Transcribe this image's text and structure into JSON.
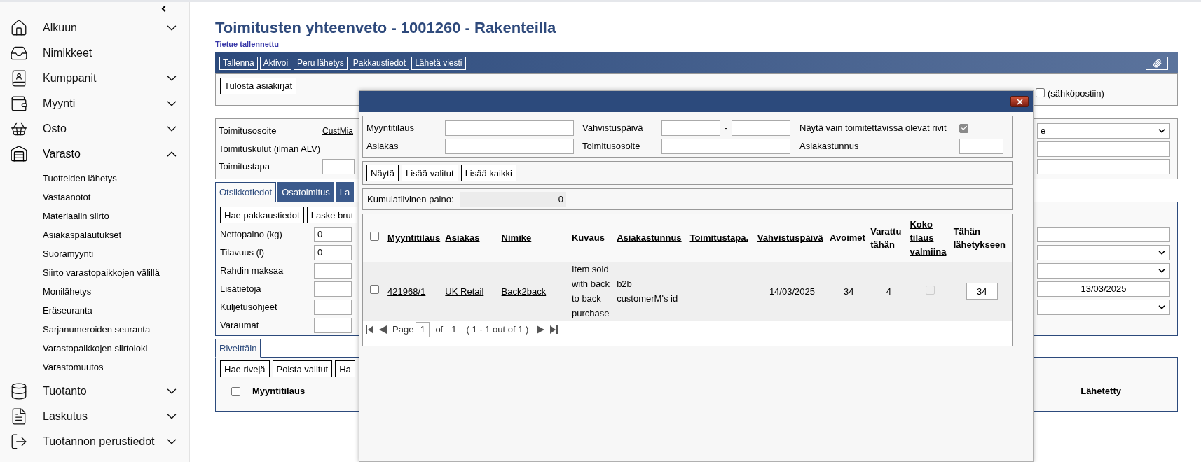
{
  "sidebar": {
    "items": [
      {
        "label": "Alkuun",
        "kind": "group",
        "expanded": false
      },
      {
        "label": "Nimikkeet",
        "kind": "link"
      },
      {
        "label": "Kumppanit",
        "kind": "group",
        "expanded": false
      },
      {
        "label": "Myynti",
        "kind": "group",
        "expanded": false
      },
      {
        "label": "Osto",
        "kind": "group",
        "expanded": false
      },
      {
        "label": "Varasto",
        "kind": "group",
        "expanded": true,
        "children": [
          {
            "label": "Tuotteiden lähetys"
          },
          {
            "label": "Vastaanotot"
          },
          {
            "label": "Materiaalin siirto"
          },
          {
            "label": "Asiakaspalautukset"
          },
          {
            "label": "Suoramyynti"
          },
          {
            "label": "Siirto varastopaikkojen välillä"
          },
          {
            "label": "Monilähetys"
          },
          {
            "label": "Eräseuranta"
          },
          {
            "label": "Sarjanumeroiden seuranta"
          },
          {
            "label": "Varastopaikkojen siirtoloki"
          },
          {
            "label": "Varastomuutos"
          }
        ]
      },
      {
        "label": "Tuotanto",
        "kind": "group",
        "expanded": false
      },
      {
        "label": "Laskutus",
        "kind": "group",
        "expanded": false
      },
      {
        "label": "Tuotannon perustiedot",
        "kind": "group",
        "expanded": false
      }
    ]
  },
  "page": {
    "title": "Toimitusten yhteenveto - 1001260 - Rakenteilla",
    "status": "Tietue tallennettu"
  },
  "toolbar": {
    "buttons": [
      "Tallenna",
      "Aktivoi",
      "Peru lähetys",
      "Pakkaustiedot",
      "Lähetä viesti"
    ]
  },
  "documents": {
    "button": "Tulosta asiakirjat",
    "email_option": {
      "label": "(sähköpostiin)",
      "checked": false
    }
  },
  "delivery": {
    "fields": [
      {
        "label": "Toimitusosoite",
        "kind": "link",
        "value": "CustMia"
      },
      {
        "label": "Toimituskulut (ilman ALV)",
        "kind": "text"
      },
      {
        "label": "Toimitustapa",
        "kind": "input"
      }
    ],
    "right_fields": [
      {
        "kind": "select",
        "value": "e"
      },
      {
        "kind": "input"
      },
      {
        "kind": "input"
      }
    ]
  },
  "details": {
    "tabs": [
      {
        "label": "Otsikkotiedot",
        "selected": true
      },
      {
        "label": "Osatoimitus",
        "selected": false
      },
      {
        "label": "La",
        "selected": false
      }
    ],
    "buttons": [
      "Hae pakkaustiedot",
      "Laske brut"
    ],
    "fields": [
      {
        "label": "Nettopaino (kg)",
        "value": "0"
      },
      {
        "label": "Tilavuus (l)",
        "value": "0"
      },
      {
        "label": "Rahdin maksaa"
      },
      {
        "label": "Lisätietoja"
      },
      {
        "label": "Kuljetusohjeet"
      },
      {
        "label": "Varaumat"
      }
    ],
    "right_fields": [
      {
        "kind": "input"
      },
      {
        "kind": "select"
      },
      {
        "kind": "select"
      },
      {
        "kind": "input",
        "value": "13/03/2025"
      },
      {
        "kind": "select"
      }
    ]
  },
  "lines": {
    "tabs": [
      {
        "label": "Riveittäin",
        "selected": true
      }
    ],
    "buttons": [
      "Hae rivejä",
      "Poista valitut",
      "Ha"
    ],
    "select_all": false,
    "columns": [
      "Myyntitilaus",
      "Lähetetty"
    ]
  },
  "dialog": {
    "filters": [
      {
        "label": "Myyntitilaus",
        "kind": "input"
      },
      {
        "label": "Vahvistuspäivä",
        "kind": "range",
        "separator": "-"
      },
      {
        "label": "Näytä vain toimitettavissa olevat rivit",
        "kind": "checkbox",
        "checked": true
      },
      {
        "label": "Asiakas",
        "kind": "input"
      },
      {
        "label": "Toimitusosoite",
        "kind": "input"
      },
      {
        "label": "Asiakastunnus",
        "kind": "short_input"
      }
    ],
    "buttons": [
      "Näytä",
      "Lisää valitut",
      "Lisää kaikki"
    ],
    "weight": {
      "label": "Kumulatiivinen paino:",
      "value": "0"
    },
    "table": {
      "select_all": false,
      "columns": [
        {
          "label": "Myyntitilaus",
          "sortable": true
        },
        {
          "label": "Asiakas",
          "sortable": true
        },
        {
          "label": "Nimike",
          "sortable": true
        },
        {
          "label": "Kuvaus",
          "sortable": false
        },
        {
          "label": "Asiakastunnus",
          "sortable": true
        },
        {
          "label": "Toimitustapa.",
          "sortable": true
        },
        {
          "label": "Vahvistuspäivä",
          "sortable": true
        },
        {
          "label": "Avoimet",
          "sortable": false
        },
        {
          "label": "Varattu tähän",
          "sortable": false
        },
        {
          "label": "Koko tilaus valmiina",
          "sortable": true
        },
        {
          "label": "Tähän lähetykseen",
          "sortable": false
        }
      ],
      "rows": [
        {
          "selected": false,
          "cells": [
            {
              "kind": "link",
              "text": "421968/1"
            },
            {
              "kind": "link",
              "text": "UK Retail"
            },
            {
              "kind": "link",
              "text": "Back2back"
            },
            {
              "kind": "text",
              "text": "Item sold with back to back purchase"
            },
            {
              "kind": "text",
              "text": "b2b customerM's id"
            },
            null,
            {
              "kind": "number",
              "text": "14/03/2025"
            },
            {
              "kind": "number",
              "text": "34"
            },
            {
              "kind": "number",
              "text": "4"
            },
            {
              "kind": "checkbox",
              "checked": false,
              "disabled": true
            },
            {
              "kind": "input",
              "text": "34"
            }
          ]
        }
      ]
    },
    "pager": {
      "page_label": "Page",
      "page": "1",
      "of_label": "of",
      "total": "1",
      "summary": "( 1 - 1 out of 1 )"
    }
  }
}
